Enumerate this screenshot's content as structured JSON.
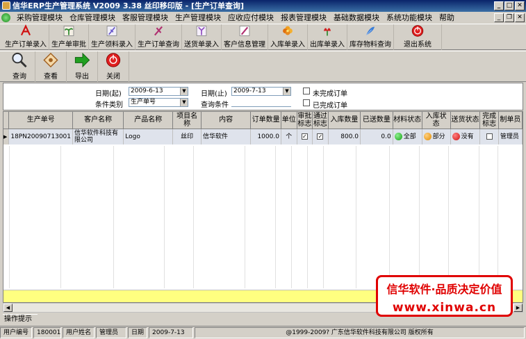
{
  "window": {
    "title": "信华ERP生产管理系统 V2009 3.38 丝印移印版 - [生产订单查询]",
    "btn_min": "_",
    "btn_max": "□",
    "btn_close": "✕",
    "mdi_min": "_",
    "mdi_restore": "❐",
    "mdi_close": "✕"
  },
  "menu": [
    "采购管理模块",
    "仓库管理模块",
    "客服管理模块",
    "生产管理模块",
    "应收应付模块",
    "报表管理模块",
    "基础数据模块",
    "系统功能模块",
    "帮助"
  ],
  "toolbar1": [
    {
      "label": "生产订单录入",
      "icon": "pdf-icon"
    },
    {
      "label": "生产单审批",
      "icon": "plant-icon"
    },
    {
      "label": "生产领料录入",
      "icon": "feather-icon"
    },
    {
      "label": "生产订单查询",
      "icon": "pen-icon"
    },
    {
      "label": "送货单录入",
      "icon": "lily-icon"
    },
    {
      "label": "客户信息管理",
      "icon": "pen-paper-icon"
    },
    {
      "label": "入库单录入",
      "icon": "flower-icon"
    },
    {
      "label": "出库单录入",
      "icon": "rose-icon"
    },
    {
      "label": "库存物料查询",
      "icon": "quill-icon"
    },
    {
      "label": "退出系统",
      "icon": "exit-icon"
    }
  ],
  "toolbar2": [
    {
      "label": "查询",
      "icon": "magnifier-icon"
    },
    {
      "label": "查看",
      "icon": "view-icon"
    },
    {
      "label": "导出",
      "icon": "arrow-right-icon"
    },
    {
      "label": "关闭",
      "icon": "close-circle-icon"
    }
  ],
  "filter": {
    "date_start_label": "日期(起)",
    "date_start_value": "2009-6-13",
    "date_end_label": "日期(止)",
    "date_end_value": "2009-7-13",
    "unfinished_label": "未完成订单",
    "category_label": "条件类别",
    "category_value": "生产单号",
    "condition_label": "查询条件",
    "condition_value": "",
    "finished_label": "已完成订单"
  },
  "table": {
    "headers": [
      "生产单号",
      "客户名称",
      "产品名称",
      "项目名称",
      "内容",
      "订单数量",
      "单位",
      "审批标志",
      "通过标志",
      "入库数量",
      "已送数量",
      "材料状态",
      "入库状态",
      "送货状态",
      "完成标志",
      "制单员"
    ],
    "rows": [
      {
        "order_no": "18PN20090713001",
        "customer": "信华软件科技有限公司",
        "product": "Logo",
        "project": "丝印",
        "content": "信华软件",
        "qty": "1000.0",
        "unit": "个",
        "approved": true,
        "passed": true,
        "in_qty": "800.0",
        "sent_qty": "0.0",
        "material_status": "全部",
        "stock_status": "部分",
        "delivery_status": "没有",
        "completed": false,
        "creator": "管理员"
      }
    ]
  },
  "colors": {
    "status_green": "#14a014",
    "status_orange": "#e08a00",
    "status_red": "#d01010"
  },
  "scroll_left": "◀",
  "scroll_right": "▶",
  "watermark": {
    "line1": "信华软件·品质决定价值",
    "line2": "www.xinwa.cn"
  },
  "hint_tab": "操作提示",
  "status": {
    "user_no_label": "用户编号",
    "user_no": "180001",
    "user_name_label": "用户姓名",
    "user_name": "管理员",
    "date_label": "日期",
    "date": "2009-7-13",
    "copyright": "@1999-2009? 广东信华软件科技有限公司 版权所有"
  }
}
